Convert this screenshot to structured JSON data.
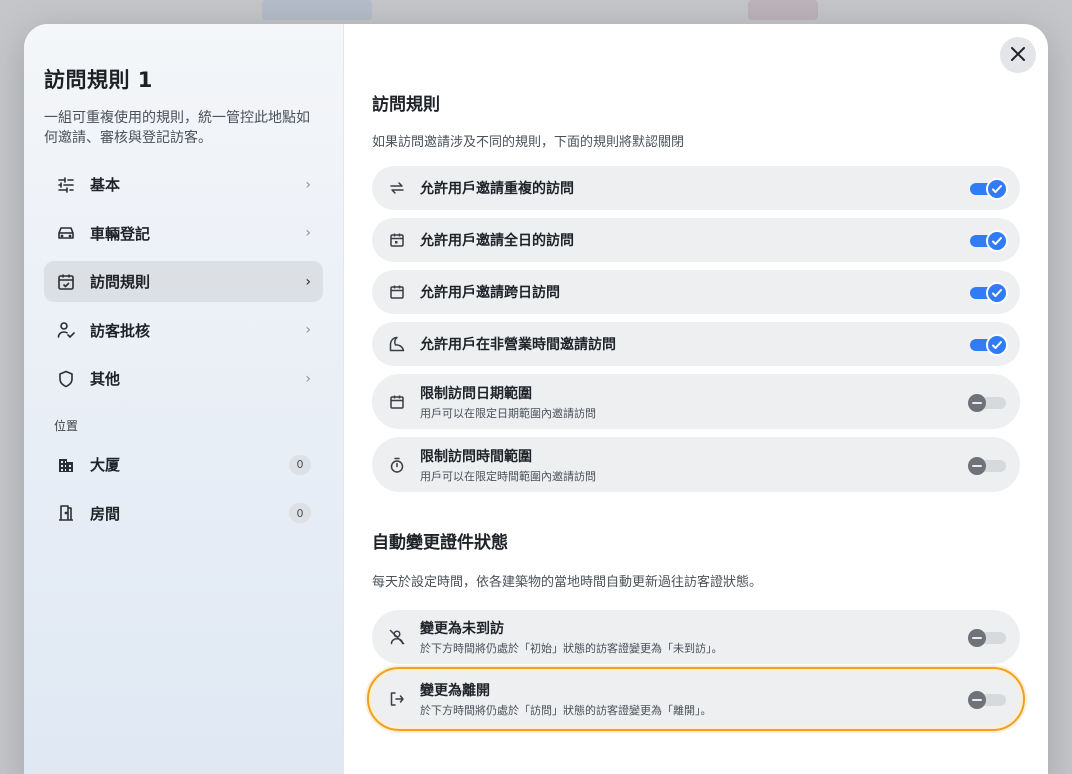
{
  "sidebar": {
    "title": "訪問規則 1",
    "description": "一組可重複使用的規則，統一管控此地點如何邀請、審核與登記訪客。",
    "nav": [
      {
        "label": "基本"
      },
      {
        "label": "車輛登記"
      },
      {
        "label": "訪問規則"
      },
      {
        "label": "訪客批核"
      },
      {
        "label": "其他"
      }
    ],
    "location_caption": "位置",
    "locations": [
      {
        "label": "大厦",
        "count": "0"
      },
      {
        "label": "房間",
        "count": "0"
      }
    ]
  },
  "main": {
    "rules": {
      "heading": "訪問規則",
      "subtitle": "如果訪問邀請涉及不同的規則，下面的規則將默認關閉",
      "items": [
        {
          "title": "允許用戶邀請重複的訪問",
          "enabled": true,
          "icon": "repeat-icon"
        },
        {
          "title": "允許用戶邀請全日的訪問",
          "enabled": true,
          "icon": "calendar-day-icon"
        },
        {
          "title": "允許用戶邀請跨日訪問",
          "enabled": true,
          "icon": "calendar-icon"
        },
        {
          "title": "允許用戶在非營業時間邀請訪問",
          "enabled": true,
          "icon": "moon-icon"
        },
        {
          "title": "限制訪問日期範圍",
          "desc": "用戶可以在限定日期範圍內邀請訪問",
          "enabled": false,
          "icon": "calendar-icon"
        },
        {
          "title": "限制訪問時間範圍",
          "desc": "用戶可以在限定時間範圍內邀請訪問",
          "enabled": false,
          "icon": "stopwatch-icon"
        }
      ]
    },
    "auto_status": {
      "heading": "自動變更證件狀態",
      "subtitle": "每天於設定時間，依各建築物的當地時間自動更新過往訪客證狀態。",
      "items": [
        {
          "title": "變更為未到訪",
          "desc": "於下方時間將仍處於「初始」狀態的訪客證變更為「未到訪」。",
          "enabled": false,
          "icon": "user-off-icon"
        },
        {
          "title": "變更為離開",
          "desc": "於下方時間將仍處於「訪問」狀態的訪客證變更為「離開」。",
          "enabled": false,
          "icon": "logout-icon"
        }
      ]
    }
  },
  "colors": {
    "accent": "#2f7cf6",
    "highlight": "#f0a020"
  }
}
